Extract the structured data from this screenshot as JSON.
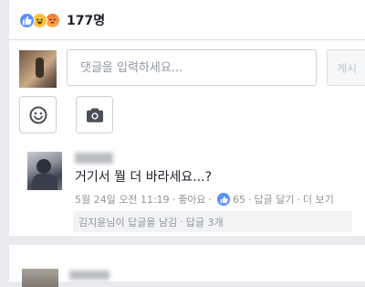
{
  "reactions": {
    "icons": [
      "like-icon",
      "haha-icon",
      "angry-icon"
    ],
    "count": "177명"
  },
  "composer": {
    "placeholder": "댓글을 입력하세요...",
    "post_label": "게시",
    "tools": [
      "smile-icon",
      "camera-icon"
    ]
  },
  "comment": {
    "text": "거기서 뭘 더 바라세요...?",
    "date": "5월 24일 오전 11:19",
    "like_label": "좋아요",
    "like_count": "65",
    "reply_label": "답글 달기",
    "more_label": "더 보기",
    "separator": "·",
    "reply_summary": {
      "text": "김지윤님이 답글을 남김",
      "count_label": "답글 3개"
    }
  },
  "colors": {
    "like_blue": "#5890ff",
    "background": "#e9ebee",
    "meta_gray": "#90949c"
  }
}
